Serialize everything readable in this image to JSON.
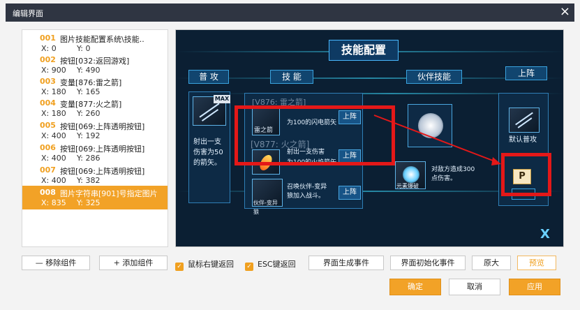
{
  "window": {
    "title": "编辑界面",
    "close_icon": "×"
  },
  "components": [
    {
      "num": "001",
      "name": "图片技能配置系统\\技能..",
      "x": "X: 0",
      "y": "Y: 0"
    },
    {
      "num": "002",
      "name": "按钮[032:返回游戏]",
      "x": "X: 900",
      "y": "Y: 490"
    },
    {
      "num": "003",
      "name": "变量[876:雷之箭]",
      "x": "X: 180",
      "y": "Y: 165"
    },
    {
      "num": "004",
      "name": "变量[877:火之箭]",
      "x": "X: 180",
      "y": "Y: 260"
    },
    {
      "num": "005",
      "name": "按钮[069:上阵透明按钮]",
      "x": "X: 400",
      "y": "Y: 192"
    },
    {
      "num": "006",
      "name": "按钮[069:上阵透明按钮]",
      "x": "X: 400",
      "y": "Y: 286"
    },
    {
      "num": "007",
      "name": "按钮[069:上阵透明按钮]",
      "x": "X: 400",
      "y": "Y: 382"
    },
    {
      "num": "008",
      "name": "图片字符串[901]号指定图片",
      "x": "X: 835",
      "y": "Y: 325"
    }
  ],
  "preview": {
    "title": "技能配置",
    "headers": {
      "basic": "普 攻",
      "skills": "技 能",
      "partner": "伙伴技能",
      "deploy": "上阵"
    },
    "max_badge": "MAX",
    "basic_desc": "射出一支伤害为50的箭矢。",
    "skill1": {
      "faded": "[V876: 雷之箭]",
      "icon_label": "雷之箭",
      "desc": "为100的闪电箭矢",
      "btn": "上阵"
    },
    "skill2": {
      "faded": "[V877: 火之箭]",
      "desc_top": "射出一支伤害",
      "desc": "为100的火焰箭矢",
      "btn": "上阵"
    },
    "skill3": {
      "icon_label": "伙伴-变异狼",
      "desc": "召唤伙伴-变异狼加入战斗。",
      "btn": "上阵"
    },
    "partner": {
      "icon_label": "元素爆破",
      "desc": "对敌方造成300点伤害。"
    },
    "deploy": {
      "default_label": "默认普攻",
      "p_icon": "P"
    },
    "logo": "X"
  },
  "buttons": {
    "remove": "— 移除组件",
    "add": "+ 添加组件",
    "right_click_back": "鼠标右键返回",
    "esc_back": "ESC键返回",
    "gen_event": "界面生成事件",
    "init_event": "界面初始化事件",
    "enlarge": "原大",
    "preview": "预览",
    "ok": "确定",
    "cancel": "取消",
    "apply": "应用"
  },
  "colors": {
    "accent": "#f2a227",
    "titlebar": "#2f3542",
    "highlight_box": "#e41818",
    "preview_bg": "#0b1f33"
  }
}
